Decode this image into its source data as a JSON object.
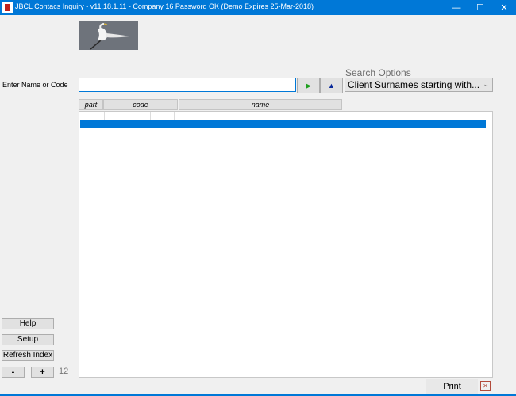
{
  "window": {
    "title": "JBCL Contacs Inquiry - v11.18.1.11 -  Company 16 Password OK  (Demo Expires 25-Mar-2018)",
    "minimize_glyph": "—",
    "maximize_glyph": "☐",
    "close_glyph": "✕"
  },
  "search": {
    "label": "Enter Name or Code",
    "value": "",
    "next_glyph": "▶",
    "prev_glyph": "▲"
  },
  "search_options": {
    "label": "Search Options",
    "selected": "Client Surnames starting with...",
    "arrow": "⌄"
  },
  "columns": [
    "part",
    "code",
    "name"
  ],
  "sidebar": {
    "help": "Help",
    "setup": "Setup",
    "refresh": "Refresh Index",
    "minus": "-",
    "plus": "+",
    "count": "12"
  },
  "footer": {
    "print": "Print",
    "close_glyph": "✕"
  },
  "colors": {
    "accent": "#0078d7",
    "next_arrow": "#1fa01f",
    "prev_arrow": "#0a2a9a"
  }
}
